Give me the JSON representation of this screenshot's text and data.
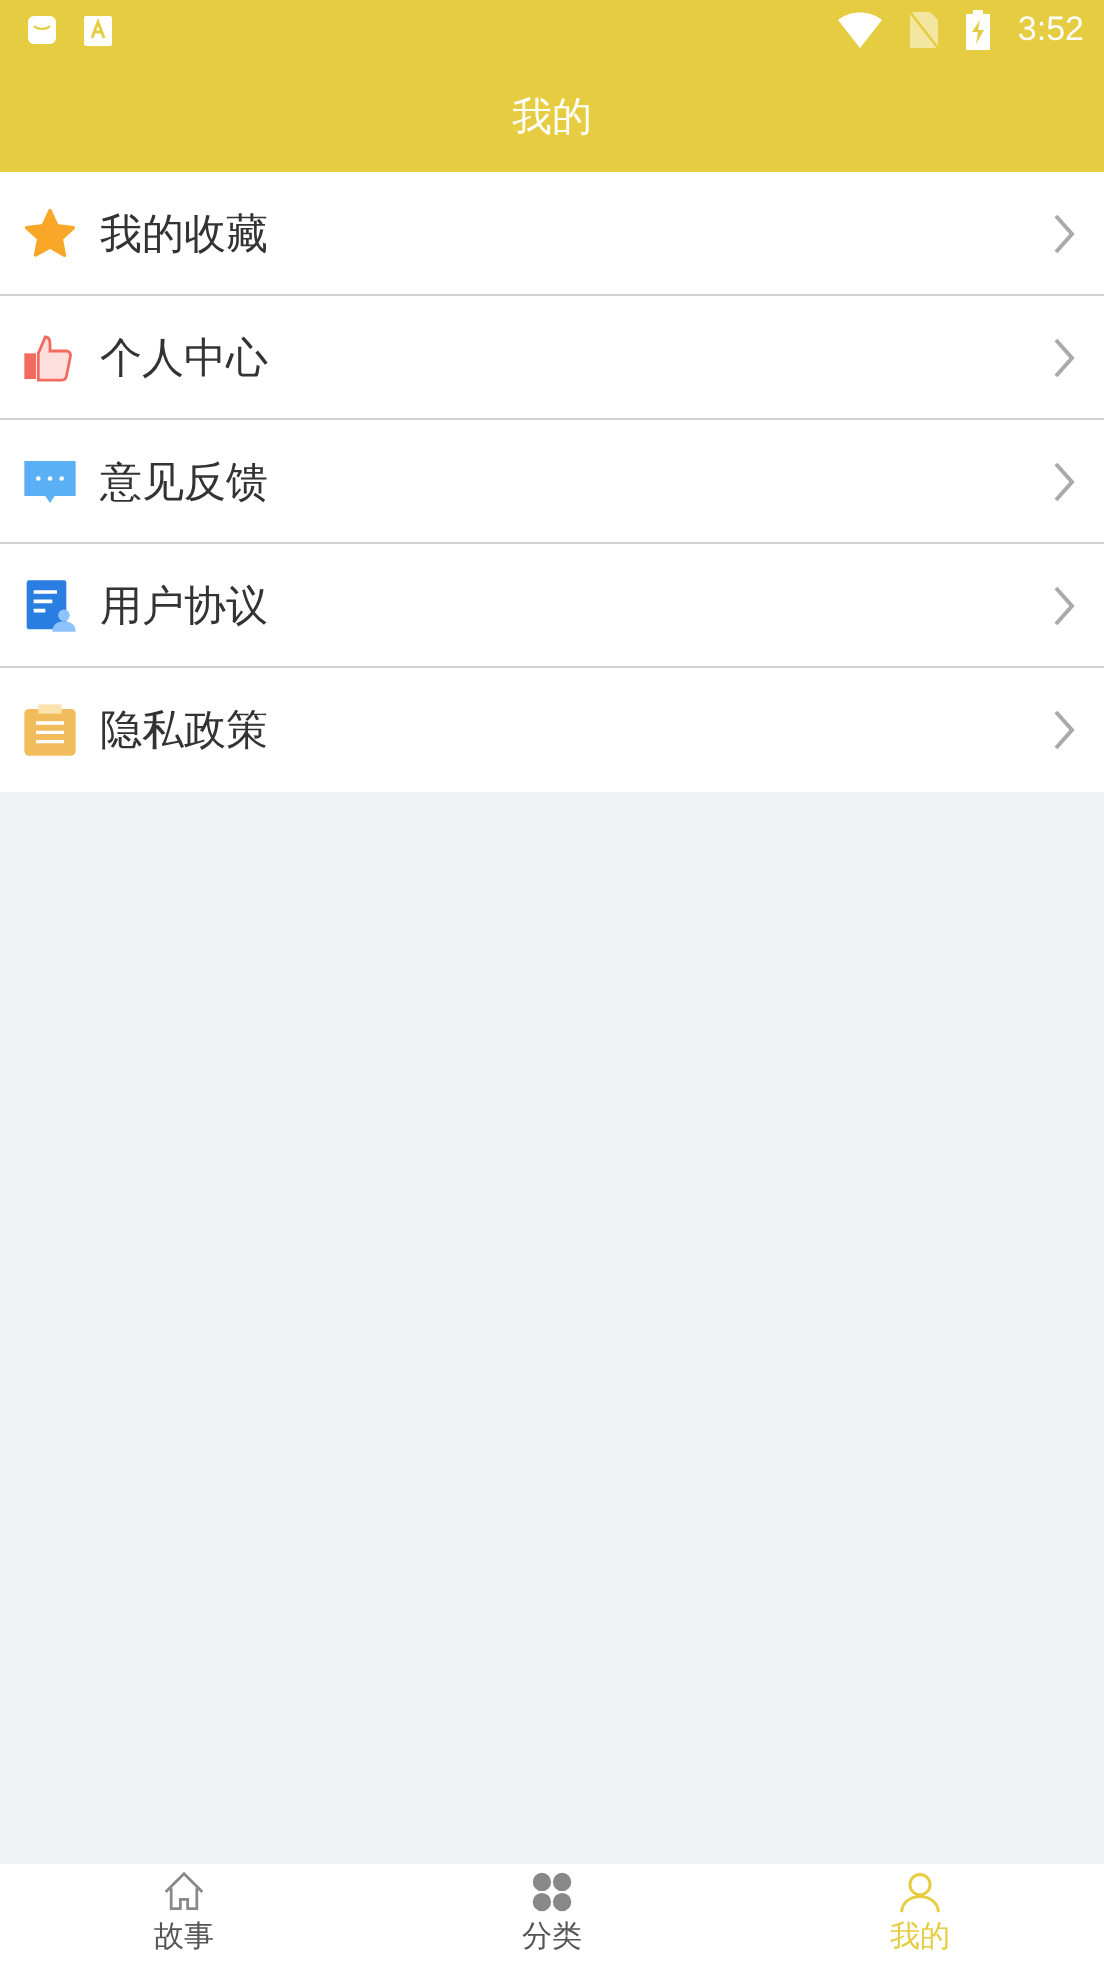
{
  "status_bar": {
    "time": "3:52"
  },
  "header": {
    "title": "我的"
  },
  "menu": [
    {
      "label": "我的收藏",
      "kind": "star"
    },
    {
      "label": "个人中心",
      "kind": "thumb"
    },
    {
      "label": "意见反馈",
      "kind": "chat"
    },
    {
      "label": "用户协议",
      "kind": "doc"
    },
    {
      "label": "隐私政策",
      "kind": "clipboard"
    }
  ],
  "tabs": [
    {
      "label": "故事",
      "kind": "home",
      "selected": false
    },
    {
      "label": "分类",
      "kind": "grid",
      "selected": false
    },
    {
      "label": "我的",
      "kind": "user",
      "selected": true
    }
  ]
}
